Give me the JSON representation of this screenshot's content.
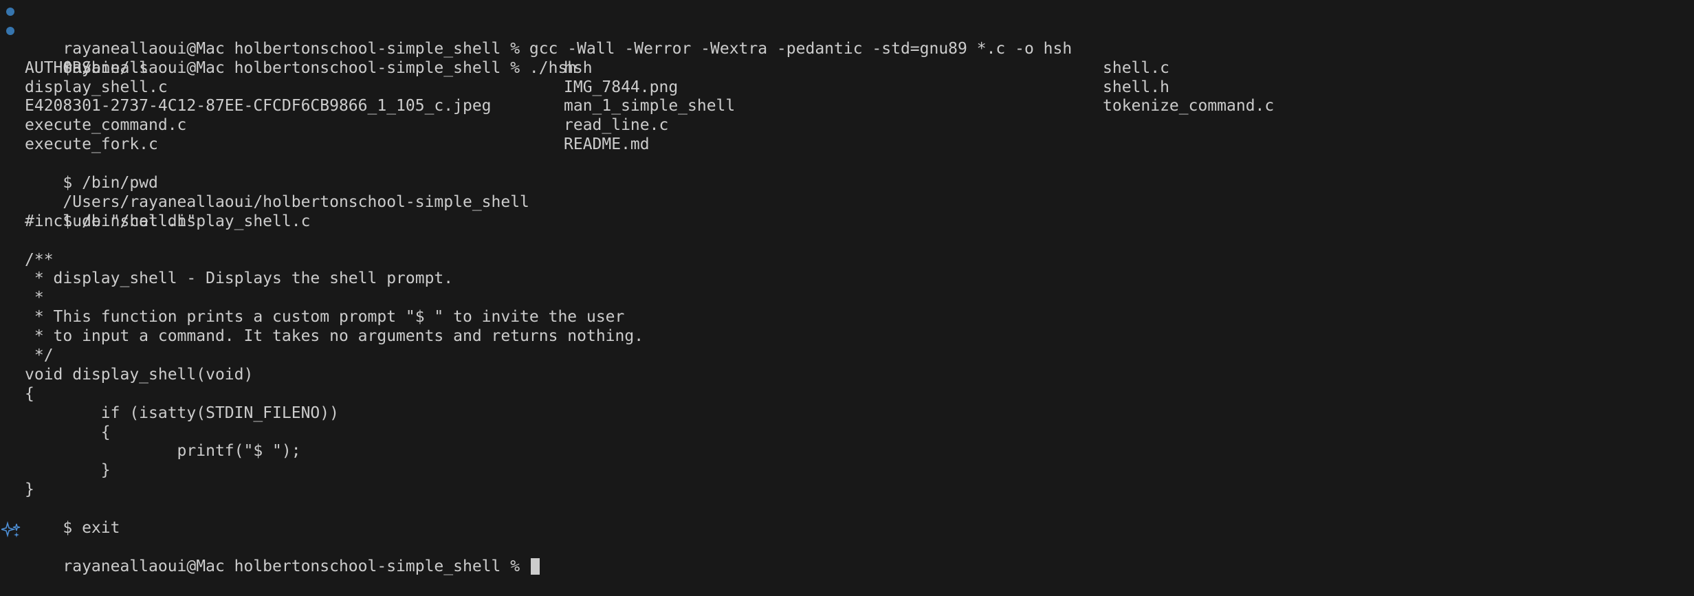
{
  "terminal": {
    "prompt_line_1": "rayaneallaoui@Mac holbertonschool-simple_shell % gcc -Wall -Werror -Wextra -pedantic -std=gnu89 *.c -o hsh",
    "prompt_line_2": "rayaneallaoui@Mac holbertonschool-simple_shell % ./hsh",
    "cmd_ls": "$ /bin/ls",
    "ls_output": [
      [
        "AUTHORS",
        "hsh",
        "shell.c"
      ],
      [
        "display_shell.c",
        "IMG_7844.png",
        "shell.h"
      ],
      [
        "E4208301-2737-4C12-87EE-CFCDF6CB9866_1_105_c.jpeg",
        "man_1_simple_shell",
        "tokenize_command.c"
      ],
      [
        "execute_command.c",
        "read_line.c",
        ""
      ],
      [
        "execute_fork.c",
        "README.md",
        ""
      ]
    ],
    "cmd_pwd": "$ /bin/pwd",
    "pwd_output": "/Users/rayaneallaoui/holbertonschool-simple_shell",
    "cmd_cat": "$ /bin/cat display_shell.c",
    "cat_output": [
      "#include \"shell.h\"",
      "",
      "/**",
      " * display_shell - Displays the shell prompt.",
      " *",
      " * This function prints a custom prompt \"$ \" to invite the user",
      " * to input a command. It takes no arguments and returns nothing.",
      " */",
      "void display_shell(void)",
      "{",
      "        if (isatty(STDIN_FILENO))",
      "        {",
      "                printf(\"$ \");",
      "        }",
      "}"
    ],
    "cmd_exit": "$ exit",
    "final_prompt": "rayaneallaoui@Mac holbertonschool-simple_shell % ",
    "colors": {
      "background": "#181818",
      "text": "#cccccc",
      "decoration_dot": "#3a7fbf",
      "sparkle": "#4d8fd6"
    }
  }
}
